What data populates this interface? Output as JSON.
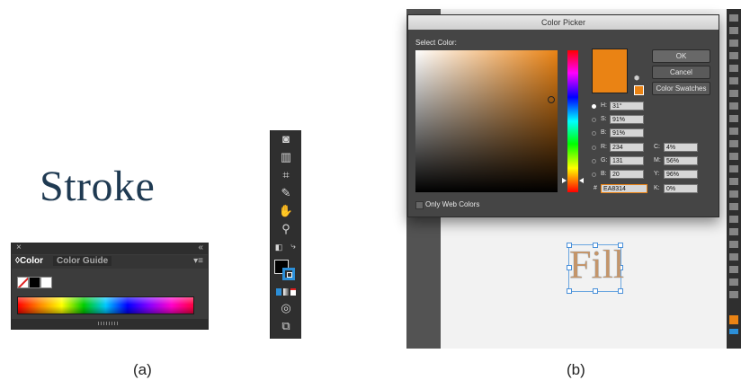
{
  "panel_a": {
    "caption": "(a)",
    "stroke_text": "Stroke",
    "color_panel": {
      "close_glyph": "×",
      "collapse_glyph": "«",
      "tabs": [
        "◊Color",
        "Color Guide"
      ],
      "menu_glyph": "▾≡"
    },
    "tools": [
      "object-icon",
      "graph-icon",
      "artboard-icon",
      "slice-icon",
      "hand-icon",
      "zoom-icon",
      "default-colors-icon",
      "swap-icon",
      "fill-stroke-icon",
      "draw-modes-icon",
      "screen-mode-icon"
    ]
  },
  "panel_b": {
    "caption": "(b)",
    "fill_text": "Fill",
    "picker": {
      "title": "Color Picker",
      "select_label": "Select Color:",
      "only_web_label": "Only Web Colors",
      "buttons": {
        "ok": "OK",
        "cancel": "Cancel",
        "swatches": "Color Swatches"
      },
      "fields": {
        "h": {
          "label": "H:",
          "value": "31°"
        },
        "s": {
          "label": "S:",
          "value": "91%"
        },
        "b": {
          "label": "B:",
          "value": "91%"
        },
        "r": {
          "label": "R:",
          "value": "234"
        },
        "g": {
          "label": "G:",
          "value": "131"
        },
        "b2": {
          "label": "B:",
          "value": "20"
        },
        "hex": {
          "label": "#",
          "value": "EA8314"
        },
        "c": {
          "label": "C:",
          "value": "4%"
        },
        "m": {
          "label": "M:",
          "value": "56%"
        },
        "y": {
          "label": "Y:",
          "value": "96%"
        },
        "k": {
          "label": "K:",
          "value": "0%"
        }
      },
      "current_color": "#ea8314"
    }
  }
}
